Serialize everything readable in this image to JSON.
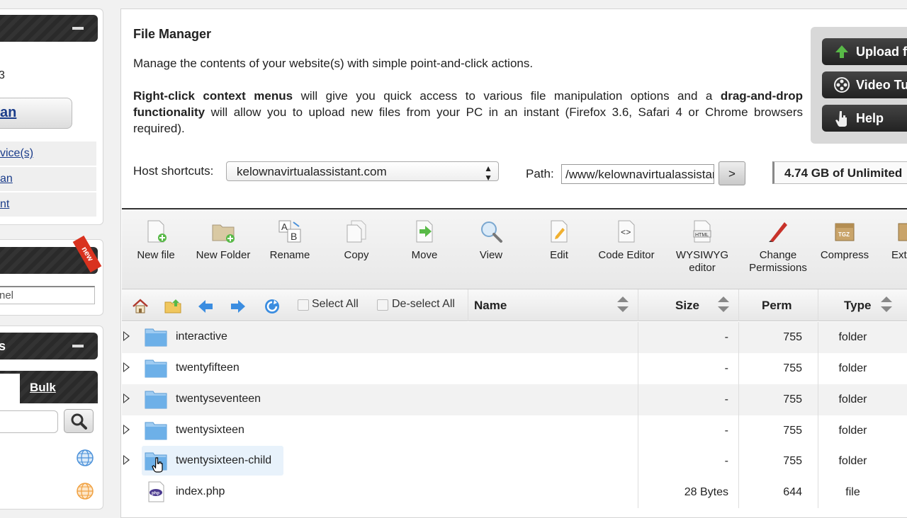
{
  "sidebar": {
    "panel1": {
      "text_num": "3",
      "plan_btn": "an",
      "links": [
        "vice(s)",
        "an",
        "nt"
      ]
    },
    "panel2": {
      "badge": "new",
      "input_value": "nel"
    },
    "panel3": {
      "title": "s",
      "tab_bulk": "Bulk"
    }
  },
  "header": {
    "title": "File Manager",
    "desc1": "Manage the contents of your website(s) with simple point-and-click actions.",
    "desc2_bold1": "Right-click context menus",
    "desc2_mid": " will give you quick access to various file manipulation options and a ",
    "desc2_bold2": "drag-and-drop functionality",
    "desc2_end": " will allow you to upload new files from your PC in an instant (Firefox 3.6, Safari 4 or Chrome browsers required)."
  },
  "right_buttons": [
    "Upload f",
    "Video Tu",
    "Help"
  ],
  "host": {
    "label": "Host shortcuts:",
    "value": "kelownavirtualassistant.com"
  },
  "path": {
    "label": "Path:",
    "value": "/www/kelownavirtualassistant.com",
    "go": ">"
  },
  "quota": "4.74 GB of Unlimited",
  "toolbar": [
    "New file",
    "New Folder",
    "Rename",
    "Copy",
    "Move",
    "View",
    "Edit",
    "Code Editor",
    "WYSIWYG editor",
    "Change Permissions",
    "Compress",
    "Ext"
  ],
  "grid": {
    "select_all": "Select All",
    "deselect_all": "De-select All",
    "columns": {
      "name": "Name",
      "size": "Size",
      "perm": "Perm",
      "type": "Type"
    },
    "rows": [
      {
        "name": "interactive",
        "size": "-",
        "perm": "755",
        "type": "folder"
      },
      {
        "name": "twentyfifteen",
        "size": "-",
        "perm": "755",
        "type": "folder"
      },
      {
        "name": "twentyseventeen",
        "size": "-",
        "perm": "755",
        "type": "folder"
      },
      {
        "name": "twentysixteen",
        "size": "-",
        "perm": "755",
        "type": "folder"
      },
      {
        "name": "twentysixteen-child",
        "size": "-",
        "perm": "755",
        "type": "folder"
      },
      {
        "name": "index.php",
        "size": "28 Bytes",
        "perm": "644",
        "type": "file"
      }
    ]
  },
  "colors": {
    "accent": "#1a3c8a",
    "folder": "#6db0e8",
    "badge": "#d9321f",
    "green": "#58b947"
  }
}
